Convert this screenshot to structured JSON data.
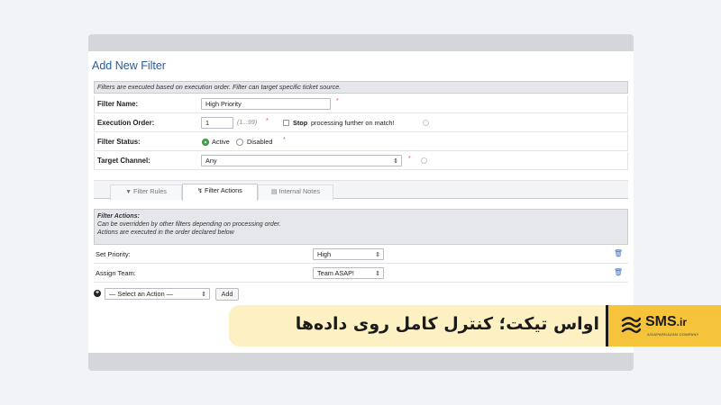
{
  "form": {
    "title": "Add New Filter",
    "info": "Filters are executed based on execution order. Filter can target specific ticket source.",
    "filter_name": {
      "label": "Filter Name:",
      "value": "High Priority"
    },
    "execution_order": {
      "label": "Execution Order:",
      "value": "1",
      "hint": "(1...99)",
      "stop_label": "Stop",
      "stop_suffix": "processing further on match!"
    },
    "filter_status": {
      "label": "Filter Status:",
      "active": "Active",
      "disabled": "Disabled",
      "selected": "Active"
    },
    "target_channel": {
      "label": "Target Channel:",
      "value": "Any"
    },
    "required_mark": "*"
  },
  "tabs": [
    {
      "label": "Filter Rules",
      "icon": "filter-icon"
    },
    {
      "label": "Filter Actions",
      "icon": "bolt-icon",
      "active": true
    },
    {
      "label": "Internal Notes",
      "icon": "notes-icon"
    }
  ],
  "actions": {
    "heading": "Filter Actions:",
    "line1": "Can be overridden by other filters depending on processing order.",
    "line2": "Actions are executed in the order declared below",
    "rows": [
      {
        "label": "Set Priority:",
        "value": "High"
      },
      {
        "label": "Assign Team:",
        "value": "Team ASAP!"
      }
    ],
    "select_placeholder": "— Select an Action —",
    "add_label": "Add"
  },
  "banner": {
    "text": "اواس تیکت؛ کنترل کامل روی داده‌ها",
    "logo_main": "SMS",
    "logo_tld": ".ir",
    "logo_sub": "ASIAPARDAZAN COMPANY"
  },
  "colors": {
    "accent": "#2a5b99",
    "banner_bg": "#fdf1c4",
    "logo_bg": "#f6c43a",
    "active_radio": "#48a54a"
  }
}
